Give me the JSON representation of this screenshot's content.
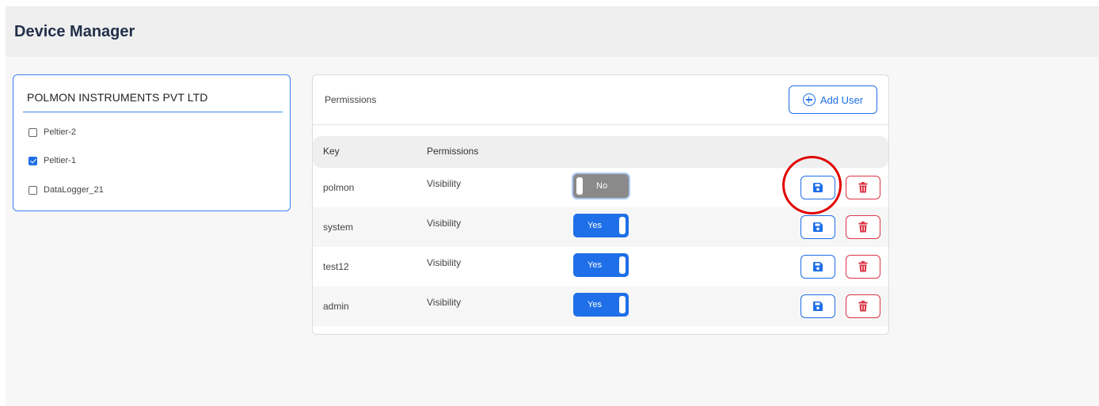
{
  "header": {
    "title": "Device Manager"
  },
  "devices": {
    "company": "POLMON INSTRUMENTS PVT LTD",
    "items": [
      {
        "label": "Peltier-2",
        "checked": false
      },
      {
        "label": "Peltier-1",
        "checked": true
      },
      {
        "label": "DataLogger_21",
        "checked": false
      }
    ]
  },
  "permissions": {
    "title": "Permissions",
    "add_user_label": "Add User",
    "columns": {
      "key": "Key",
      "permissions": "Permissions"
    },
    "rows": [
      {
        "key": "polmon",
        "permission": "Visibility",
        "toggle": "No"
      },
      {
        "key": "system",
        "permission": "Visibility",
        "toggle": "Yes"
      },
      {
        "key": "test12",
        "permission": "Visibility",
        "toggle": "Yes"
      },
      {
        "key": "admin",
        "permission": "Visibility",
        "toggle": "Yes"
      }
    ]
  },
  "colors": {
    "accent": "#1e6fe8",
    "danger": "#dc3545",
    "highlight": "#e00000"
  },
  "icons": {
    "add": "plus-circle-icon",
    "save": "floppy-disk-icon",
    "delete": "trash-icon"
  }
}
